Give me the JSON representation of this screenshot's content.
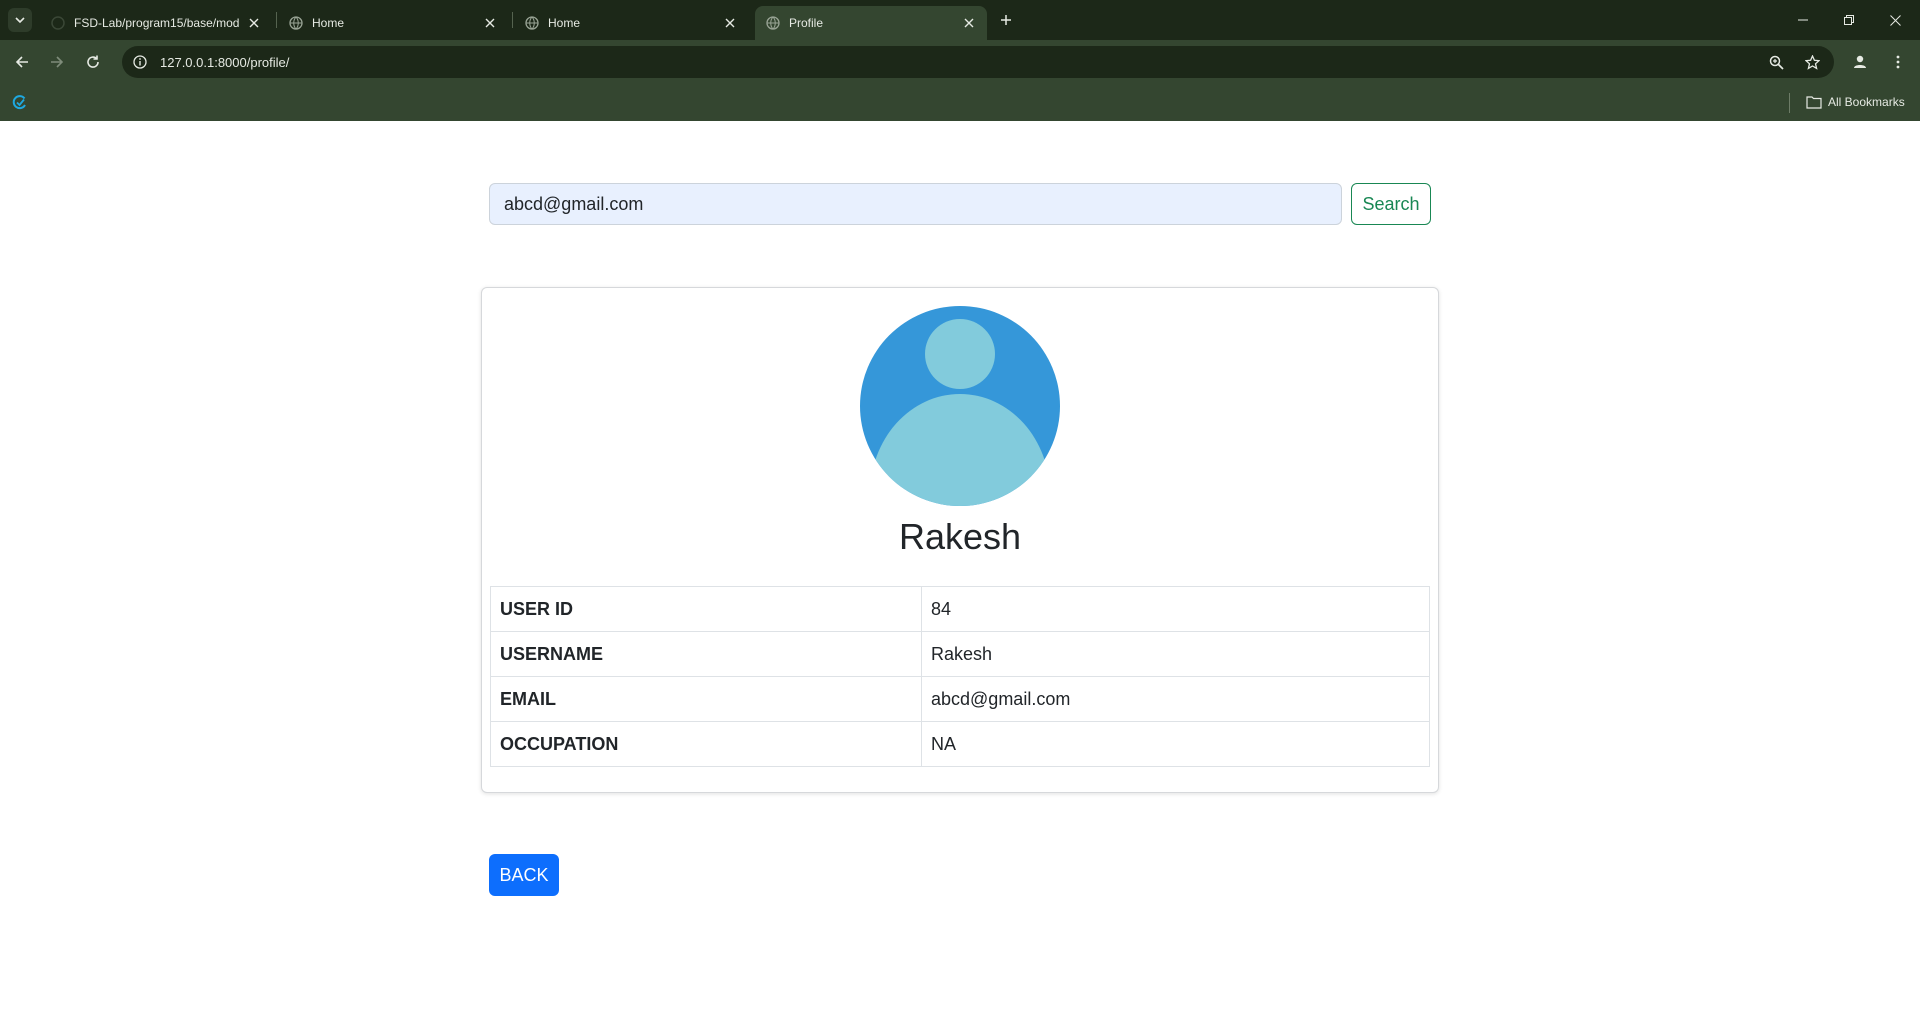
{
  "browser": {
    "tabs": [
      {
        "title": "FSD-Lab/program15/base/mod",
        "active": false
      },
      {
        "title": "Home",
        "active": false
      },
      {
        "title": "Home",
        "active": false
      },
      {
        "title": "Profile",
        "active": true
      }
    ],
    "url": "127.0.0.1:8000/profile/",
    "bookmarks_label": "All Bookmarks"
  },
  "search": {
    "value": "abcd@gmail.com",
    "button_label": "Search"
  },
  "profile": {
    "name": "Rakesh",
    "rows": [
      {
        "label": "USER ID",
        "value": "84"
      },
      {
        "label": "USERNAME",
        "value": "Rakesh"
      },
      {
        "label": "EMAIL",
        "value": "abcd@gmail.com"
      },
      {
        "label": "OCCUPATION",
        "value": "NA"
      }
    ]
  },
  "back_label": "BACK",
  "colors": {
    "chrome_dark": "#1c2818",
    "chrome_toolbar": "#344630",
    "avatar_bg": "#3597d9",
    "avatar_fg": "#82cbdc",
    "search_btn": "#198754",
    "back_btn": "#0d6efd"
  }
}
